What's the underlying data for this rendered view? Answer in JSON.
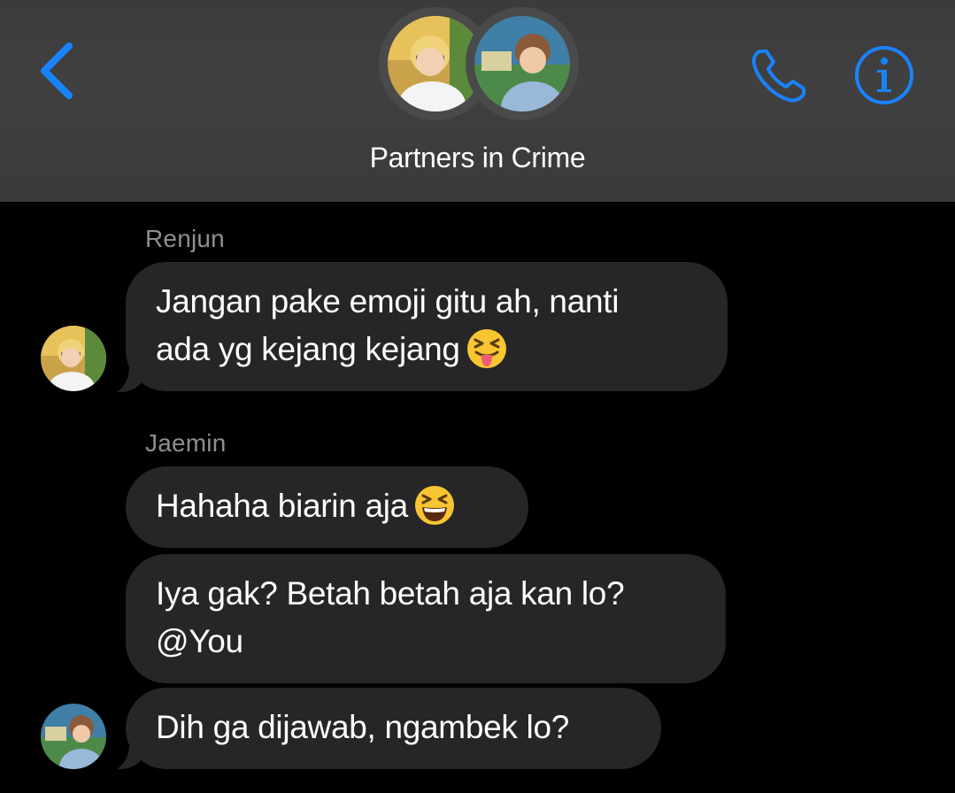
{
  "header": {
    "group_name": "Partners in Crime",
    "accent_color": "#1a82fb",
    "back_icon": "chevron-left-icon",
    "phone_icon": "phone-icon",
    "info_icon": "info-icon"
  },
  "messages": [
    {
      "sender": "Renjun",
      "lines": [
        "Jangan pake emoji gitu ah, nanti",
        "ada yg kejang kejang"
      ],
      "emoji": "squinting-tongue-face"
    },
    {
      "sender": "Jaemin",
      "lines": [
        "Hahaha biarin aja"
      ],
      "emoji": "grinning-squinting-face"
    },
    {
      "lines": [
        "Iya gak? Betah betah aja kan lo?",
        "@You"
      ]
    },
    {
      "lines": [
        "Dih ga dijawab, ngambek lo?"
      ]
    }
  ]
}
